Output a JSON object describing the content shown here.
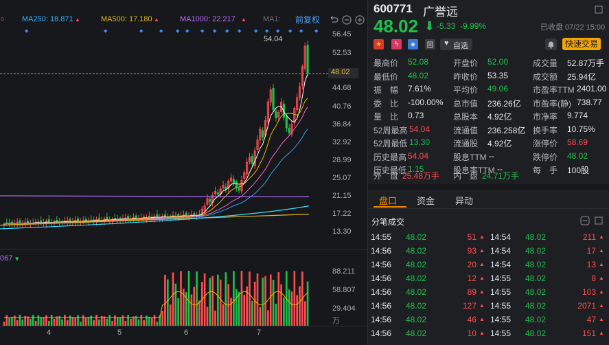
{
  "chart": {
    "ma_labels": [
      {
        "text": "MA250: 18.871",
        "color": "#36b4ff"
      },
      {
        "text": "MA500: 17.180",
        "color": "#e6b422"
      },
      {
        "text": "MA1000: 22.217",
        "color": "#b76dff"
      },
      {
        "text": "MA1:",
        "color": "#6b6e75"
      }
    ],
    "right_adjust_label": "前复权",
    "peak_label": "54.04",
    "current_price_tag": "48.02",
    "price_axis": [
      "56.45",
      "52.53",
      "48.02",
      "44.68",
      "40.76",
      "36.84",
      "32.92",
      "28.99",
      "25.07",
      "21.15",
      "17.22",
      "13.30"
    ],
    "volume_axis": [
      "88.211",
      "58.807",
      "29.404"
    ],
    "volume_unit": "万",
    "volume_label_partial": "067",
    "x_axis": [
      "4",
      "5",
      "6",
      "7"
    ]
  },
  "header": {
    "code": "600771",
    "name": "广誉远",
    "price": "48.02",
    "change": "-5.33",
    "change_pct": "-9.99%",
    "close_time": "已收盘 07/22 15:00",
    "fav_label": "自选",
    "trade_button": "快速交易"
  },
  "stats": [
    [
      {
        "l": "最高价",
        "v": "52.08",
        "c": "green"
      },
      {
        "l": "开盘价",
        "v": "52.00",
        "c": "green"
      },
      {
        "l": "成交量",
        "v": "52.87万手",
        "c": "white"
      }
    ],
    [
      {
        "l": "最低价",
        "v": "48.02",
        "c": "green"
      },
      {
        "l": "昨收价",
        "v": "53.35",
        "c": "white"
      },
      {
        "l": "成交额",
        "v": "25.94亿",
        "c": "white"
      }
    ],
    [
      {
        "l": "振　幅",
        "v": "7.61%",
        "c": "white"
      },
      {
        "l": "平均价",
        "v": "49.06",
        "c": "green"
      },
      {
        "l": "市盈率TTM",
        "v": "2401.00",
        "c": "white"
      }
    ],
    [
      {
        "l": "委　比",
        "v": "-100.00%",
        "c": "white"
      },
      {
        "l": "总市值",
        "v": "236.26亿",
        "c": "white"
      },
      {
        "l": "市盈率(静)",
        "v": "738.77",
        "c": "white"
      }
    ],
    [
      {
        "l": "量　比",
        "v": "0.73",
        "c": "white"
      },
      {
        "l": "总股本",
        "v": "4.92亿",
        "c": "white"
      },
      {
        "l": "市净率",
        "v": "9.774",
        "c": "white"
      }
    ],
    [
      {
        "l": "52周最高",
        "v": "54.04",
        "c": "red"
      },
      {
        "l": "流通值",
        "v": "236.258亿",
        "c": "white"
      },
      {
        "l": "换手率",
        "v": "10.75%",
        "c": "white"
      }
    ],
    [
      {
        "l": "52周最低",
        "v": "13.30",
        "c": "green"
      },
      {
        "l": "流通股",
        "v": "4.92亿",
        "c": "white"
      },
      {
        "l": "涨停价",
        "v": "58.69",
        "c": "red"
      }
    ],
    [
      {
        "l": "历史最高",
        "v": "54.04",
        "c": "red"
      },
      {
        "l": "股息TTM",
        "v": "--",
        "c": "white"
      },
      {
        "l": "跌停价",
        "v": "48.02",
        "c": "green"
      }
    ],
    [
      {
        "l": "历史最低",
        "v": "1.15",
        "c": "green"
      },
      {
        "l": "股息率TTM",
        "v": "--",
        "c": "white"
      },
      {
        "l": "每　手",
        "v": "100股",
        "c": "white"
      }
    ]
  ],
  "outer": {
    "label": "外　盘",
    "value": "25.48万手"
  },
  "inner": {
    "label": "内　盘",
    "value": "24.71万手"
  },
  "tabs": [
    "盘口",
    "资金",
    "异动"
  ],
  "trades_title": "分笔成交",
  "trades": [
    [
      {
        "t": "14:55",
        "p": "48.02",
        "v": "51",
        "d": "up"
      },
      {
        "t": "14:54",
        "p": "48.02",
        "v": "211",
        "d": "up"
      }
    ],
    [
      {
        "t": "14:56",
        "p": "48.02",
        "v": "93",
        "d": "up"
      },
      {
        "t": "14:54",
        "p": "48.02",
        "v": "17",
        "d": "up"
      }
    ],
    [
      {
        "t": "14:56",
        "p": "48.02",
        "v": "20",
        "d": "up"
      },
      {
        "t": "14:54",
        "p": "48.02",
        "v": "13",
        "d": "up"
      }
    ],
    [
      {
        "t": "14:56",
        "p": "48.02",
        "v": "12",
        "d": "up"
      },
      {
        "t": "14:55",
        "p": "48.02",
        "v": "8",
        "d": "up"
      }
    ],
    [
      {
        "t": "14:56",
        "p": "48.02",
        "v": "89",
        "d": "up"
      },
      {
        "t": "14:55",
        "p": "48.02",
        "v": "103",
        "d": "up"
      }
    ],
    [
      {
        "t": "14:56",
        "p": "48.02",
        "v": "127",
        "d": "up"
      },
      {
        "t": "14:55",
        "p": "48.02",
        "v": "2071",
        "d": "up"
      }
    ],
    [
      {
        "t": "14:56",
        "p": "48.02",
        "v": "46",
        "d": "up"
      },
      {
        "t": "14:55",
        "p": "48.02",
        "v": "47",
        "d": "up"
      }
    ],
    [
      {
        "t": "14:56",
        "p": "48.02",
        "v": "10",
        "d": "up"
      },
      {
        "t": "14:55",
        "p": "48.02",
        "v": "151",
        "d": "up"
      }
    ]
  ],
  "colors": {
    "up": "#ff4d4f",
    "down": "#1ec24b",
    "ma5": "#ffffff",
    "ma10": "#f5b800",
    "ma20": "#ff62c7",
    "ma30": "#2fa3ff"
  }
}
